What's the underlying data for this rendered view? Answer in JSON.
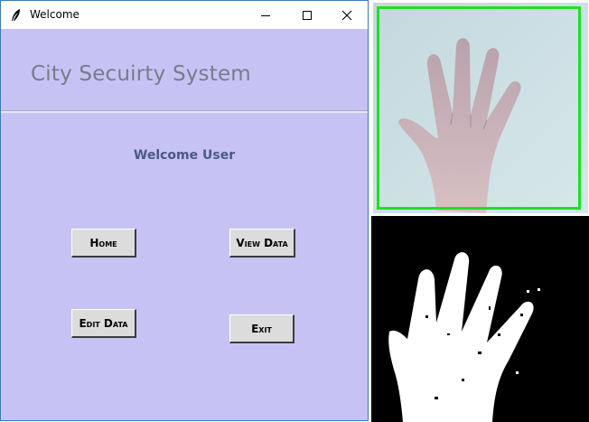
{
  "window": {
    "title": "Welcome",
    "controls": {
      "minimize": "minimize",
      "maximize": "maximize",
      "close": "close"
    }
  },
  "header": {
    "app_title": "City Secuirty System"
  },
  "main": {
    "welcome_text": "Welcome User",
    "buttons": {
      "home": "Home",
      "view_data": "View Data",
      "edit_data": "Edit Data",
      "exit": "Exit"
    }
  },
  "colors": {
    "window_bg": "#c6c3f4",
    "button_bg": "#dcdcdc",
    "detection_box": "#20e020",
    "welcome_text": "#4a5a82"
  },
  "camera": {
    "feed_icon": "hand-camera-feed",
    "mask_icon": "hand-binary-mask"
  }
}
